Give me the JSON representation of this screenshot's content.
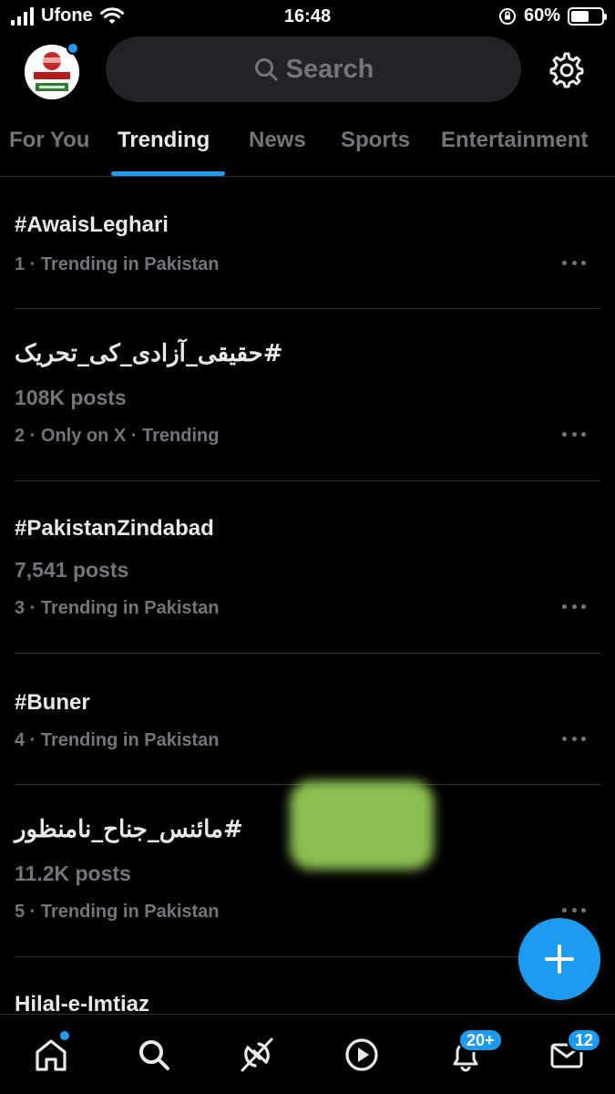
{
  "status_bar": {
    "carrier": "Ufone",
    "time": "16:48",
    "battery_percent": "60%",
    "battery_level": 0.6
  },
  "header": {
    "search_placeholder": "Search",
    "avatar_icon": "profile-logo",
    "settings_icon": "gear-icon"
  },
  "tabs": [
    {
      "label": "For You",
      "active": false
    },
    {
      "label": "Trending",
      "active": true
    },
    {
      "label": "News",
      "active": false
    },
    {
      "label": "Sports",
      "active": false
    },
    {
      "label": "Entertainment",
      "active": false
    }
  ],
  "trends": [
    {
      "name": "#AwaisLeghari",
      "posts": "",
      "meta": "1 · Trending in Pakistan"
    },
    {
      "name": "#حقیقی_آزادی_کی_تحریک",
      "posts": "108K posts",
      "meta": "2 · Only on X · Trending"
    },
    {
      "name": "#PakistanZindabad",
      "posts": "7,541 posts",
      "meta": "3 · Trending in Pakistan"
    },
    {
      "name": "#Buner",
      "posts": "",
      "meta": "4 · Trending in Pakistan"
    },
    {
      "name": "#مائنس_جناح_نامنظور",
      "posts": "11.2K posts",
      "meta": "5 · Trending in Pakistan"
    },
    {
      "name": "Hilal-e-Imtiaz",
      "posts": "",
      "meta": ""
    }
  ],
  "bottom_nav": {
    "items": [
      "home-icon",
      "search-icon",
      "grok-icon",
      "video-icon",
      "notifications-icon",
      "messages-icon"
    ],
    "notifications_badge": "20+",
    "messages_badge": "12"
  },
  "colors": {
    "accent": "#1d9bf0",
    "background": "#000000",
    "secondary_text": "#71767b",
    "primary_text": "#e7e9ea",
    "divider": "#2f3336"
  }
}
